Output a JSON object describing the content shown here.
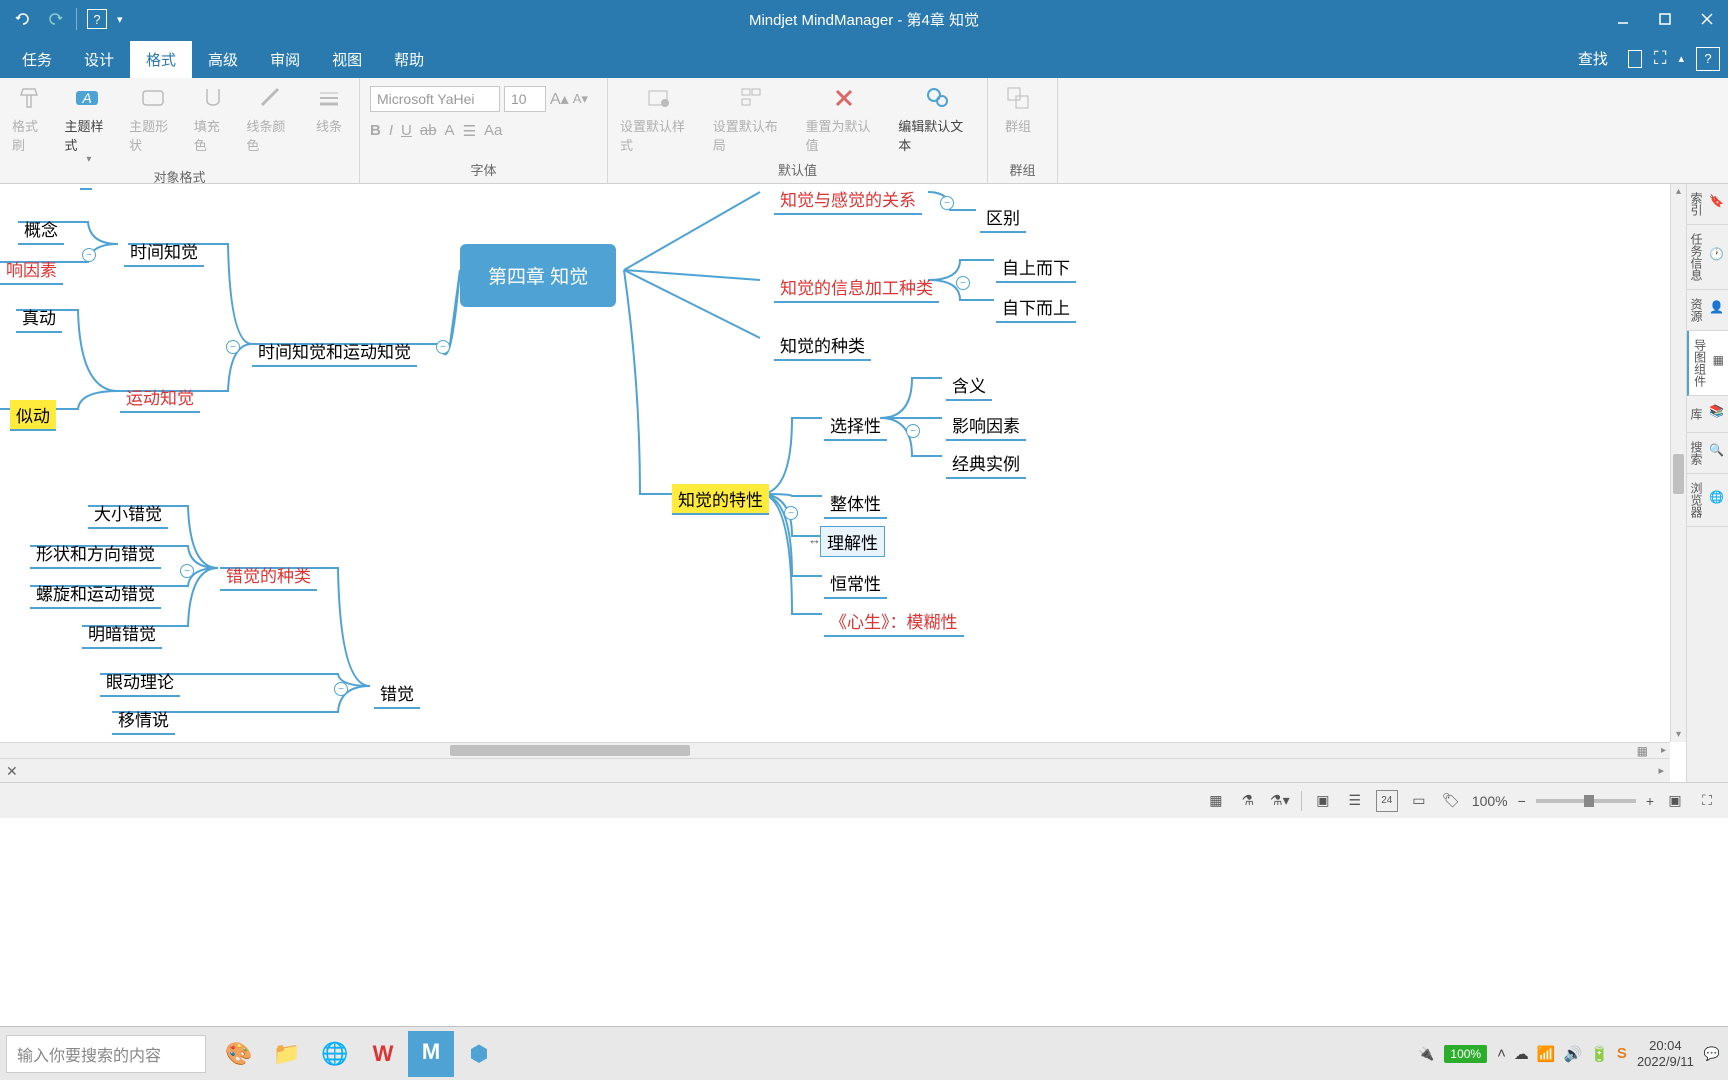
{
  "window": {
    "title": "Mindjet MindManager - 第4章 知觉"
  },
  "menu": {
    "tabs": [
      "任务",
      "设计",
      "格式",
      "高级",
      "审阅",
      "视图",
      "帮助"
    ],
    "active_index": 2,
    "find": "查找"
  },
  "ribbon": {
    "groups": {
      "object_format": {
        "label": "对象格式",
        "items": [
          "格式刷",
          "主题样式",
          "主题形状",
          "填充色",
          "线条颜色",
          "线条"
        ]
      },
      "font": {
        "label": "字体",
        "family": "Microsoft YaHei",
        "size": "10"
      },
      "defaults": {
        "label": "默认值",
        "items": [
          "设置默认样式",
          "设置默认布局",
          "重置为默认值",
          "编辑默认文本"
        ]
      },
      "group": {
        "label": "群组",
        "item": "群组"
      }
    }
  },
  "sidepanel": {
    "items": [
      "索引",
      "任务信息",
      "资源",
      "导图组件",
      "库",
      "搜索",
      "浏览器"
    ]
  },
  "statusbar": {
    "zoom": "100%"
  },
  "taskbar": {
    "search_placeholder": "输入你要搜索的内容",
    "battery": "100%",
    "time": "20:04",
    "date": "2022/9/11"
  },
  "mindmap": {
    "central": "第四章 知觉",
    "left": {
      "gainian": "概念",
      "shijian_zhijue": "时间知觉",
      "xiangying_yinsu": "响因素",
      "zhendong": "真动",
      "sidong": "似动",
      "yundong_zhijue": "运动知觉",
      "shijian_yundong": "时间知觉和运动知觉",
      "daxiao_cuojue": "大小错觉",
      "xingzhuang_fangxiang": "形状和方向错觉",
      "luoxuan_yundong": "螺旋和运动错觉",
      "mingan_cuojue": "明暗错觉",
      "cuojue_zhonglei": "错觉的种类",
      "yandong_lilun": "眼动理论",
      "yiqing_shuo": "移情说",
      "cuojue": "错觉"
    },
    "right": {
      "zhijue_ganjue": "知觉与感觉的关系",
      "qubie": "区别",
      "xinxi_jiagong": "知觉的信息加工种类",
      "zishang_erxia": "自上而下",
      "zixia_ershang": "自下而上",
      "zhijue_zhonglei": "知觉的种类",
      "zhijue_texing": "知觉的特性",
      "xuanzexing": "选择性",
      "hanyi": "含义",
      "yingxiang_yinsu": "影响因素",
      "jingdian_shili": "经典实例",
      "zhengtixing": "整体性",
      "lijiexing": "理解性",
      "hengchangxing": "恒常性",
      "xinsheng_mohu": "《心生》：模糊性"
    }
  }
}
